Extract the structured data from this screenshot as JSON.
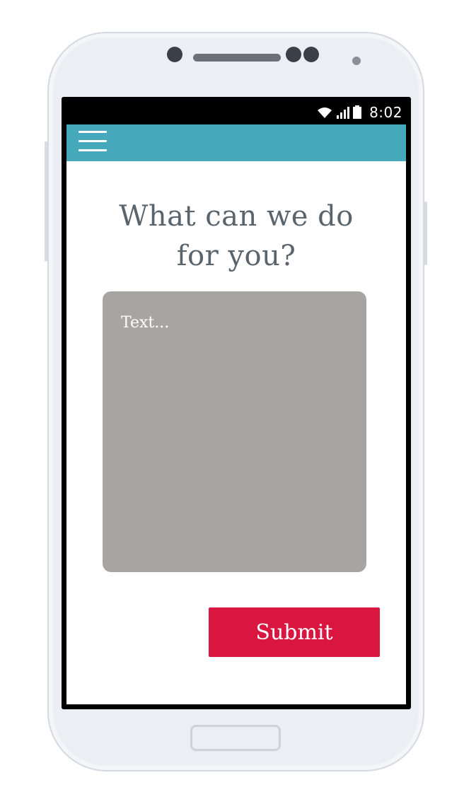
{
  "status_bar": {
    "time": "8:02",
    "wifi_icon": "wifi-icon",
    "signal_icon": "signal-icon",
    "battery_icon": "battery-icon"
  },
  "app_bar": {
    "menu_icon": "hamburger-menu-icon",
    "color": "#45a8bb"
  },
  "main": {
    "headline_line1": "What can we do",
    "headline_line2": "for you?",
    "text_input": {
      "placeholder": "Text...",
      "value": ""
    },
    "submit_label": "Submit",
    "submit_color": "#d9163f"
  }
}
